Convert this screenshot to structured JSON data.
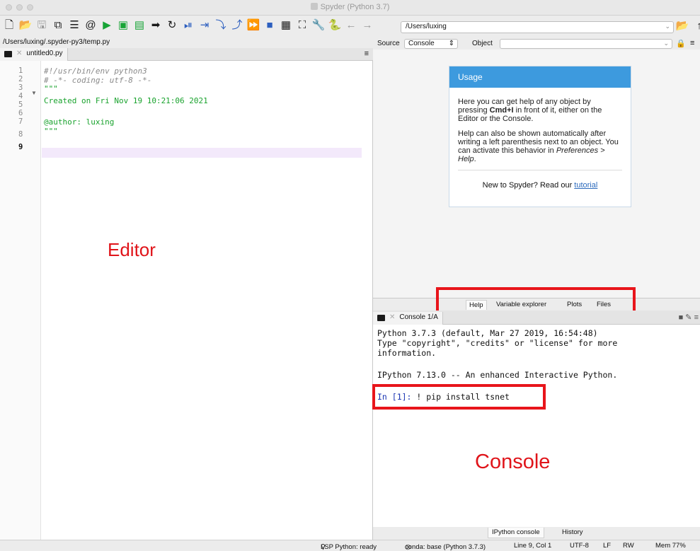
{
  "window": {
    "title": "Spyder (Python 3.7)"
  },
  "toolbar": {
    "working_directory": "/Users/luxing"
  },
  "editor": {
    "file_path": "/Users/luxing/.spyder-py3/temp.py",
    "tab_label": "untitled0.py",
    "line_numbers": [
      "1",
      "2",
      "3",
      "4",
      "5",
      "6",
      "7",
      "8",
      "9"
    ],
    "current_line": "9",
    "lines": [
      "#!/usr/bin/env python3",
      "# -*- coding: utf-8 -*-",
      "\"\"\"",
      "Created on Fri Nov 19 10:21:06 2021",
      "",
      "@author: luxing",
      "\"\"\"",
      "",
      ""
    ],
    "overlay_label": "Editor"
  },
  "help": {
    "source_label": "Source",
    "source_value": "Console",
    "object_label": "Object",
    "usage_title": "Usage",
    "usage_p1_a": "Here you can get help of any object by pressing ",
    "usage_p1_key": "Cmd+I",
    "usage_p1_b": " in front of it, either on the Editor or the Console.",
    "usage_p2_a": "Help can also be shown automatically after writing a left parenthesis next to an object. You can activate this behavior in ",
    "usage_p2_pref": "Preferences > Help",
    "usage_p2_b": ".",
    "new_text": "New to Spyder? Read our ",
    "tutorial_link": "tutorial",
    "tabs": [
      "Help",
      "Variable explorer",
      "Plots",
      "Files"
    ]
  },
  "console": {
    "tab_label": "Console 1/A",
    "banner_line1": "Python 3.7.3 (default, Mar 27 2019, 16:54:48)",
    "banner_line2": "Type \"copyright\", \"credits\" or \"license\" for more",
    "banner_line3": "information.",
    "ipython_line": "IPython 7.13.0 -- An enhanced Interactive Python.",
    "prompt": "In [1]:",
    "command": " ! pip install tsnet",
    "overlay_label": "Console",
    "bottom_tabs": [
      "IPython console",
      "History"
    ]
  },
  "statusbar": {
    "lsp": "LSP Python: ready",
    "conda": "conda: base (Python 3.7.3)",
    "position": "Line 9, Col 1",
    "encoding": "UTF-8",
    "eol": "LF",
    "mode": "RW",
    "memory": "Mem 77%"
  },
  "colors": {
    "annotation_red": "#e8151b",
    "usage_header_blue": "#3d9ade",
    "docstring_green": "#1aa32e"
  }
}
